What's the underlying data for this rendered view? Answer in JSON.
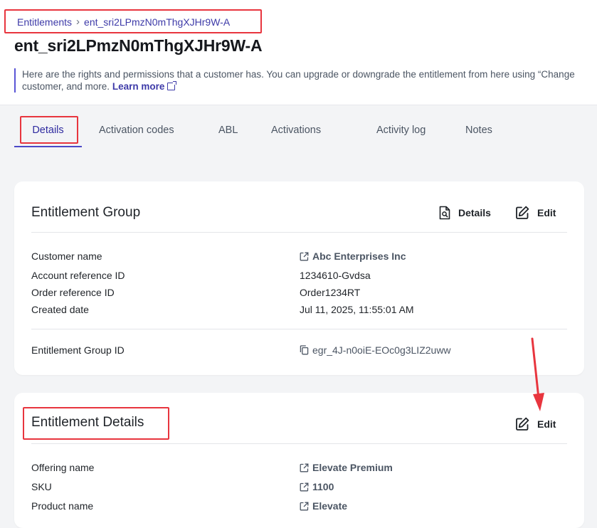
{
  "breadcrumb": {
    "parent": "Entitlements",
    "current": "ent_sri2LPmzN0mThgXJHr9W-A"
  },
  "page": {
    "title": "ent_sri2LPmzN0mThgXJHr9W-A",
    "info_line1": "Here are the rights and permissions that a customer has. You can upgrade or downgrade the entitlement from here using “Change",
    "info_line2": "customer, and more.",
    "learn_more": "Learn more"
  },
  "tabs": [
    {
      "label": "Details",
      "active": true
    },
    {
      "label": "Activation codes"
    },
    {
      "label": "ABL"
    },
    {
      "label": "Activations"
    },
    {
      "label": "Activity log"
    },
    {
      "label": "Notes"
    }
  ],
  "group_card": {
    "title": "Entitlement Group",
    "details_label": "Details",
    "edit_label": "Edit",
    "rows": [
      {
        "label": "Customer name",
        "value": "Abc Enterprises Inc"
      },
      {
        "label": "Account reference ID",
        "value": "1234610-Gvdsa"
      },
      {
        "label": "Order reference ID",
        "value": "Order1234RT"
      },
      {
        "label": "Created date",
        "value": "Jul 11, 2025, 11:55:01 AM"
      }
    ],
    "group_id_label": "Entitlement Group ID",
    "group_id_value": "egr_4J-n0oiE-EOc0g3LIZ2uww"
  },
  "details_card": {
    "title": "Entitlement Details",
    "edit_label": "Edit",
    "rows": [
      {
        "label": "Offering name",
        "value": "Elevate Premium"
      },
      {
        "label": "SKU",
        "value": "1100"
      },
      {
        "label": "Product name",
        "value": "Elevate"
      }
    ]
  },
  "colors": {
    "accent": "#4c48c8",
    "highlight": "#e8353e",
    "link": "#3d3aa8"
  }
}
